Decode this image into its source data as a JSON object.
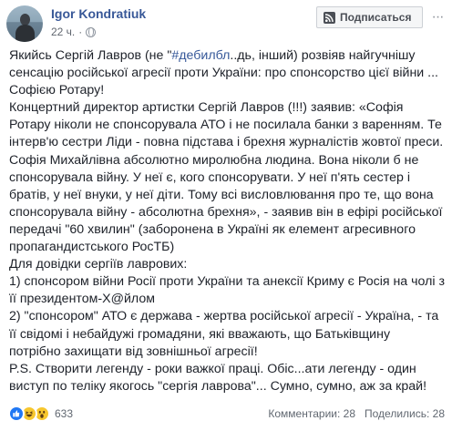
{
  "header": {
    "author": "Igor Kondratiuk",
    "time": "22 ч.",
    "separator": "·",
    "privacy_icon": "globe-icon",
    "subscribe_label": "Подписаться",
    "subscribe_icon": "rss-icon",
    "more_label": "···"
  },
  "post": {
    "p1_before": "Якийсь Сергій Лавров (не \"",
    "p1_hashtag": "#дебилбл",
    "p1_after": "..дь, інший) розвіяв найгучнішу сенсацію російської агресії проти України: про спонсорство цієї війни ... Софією Ротару!",
    "p2": "Концертний директор артистки Сергій Лавров (!!!) заявив: «Софія Ротару ніколи не спонсорувала АТО і не посилала банки з варенням. Те інтерв'ю сестри Ліди - повна підстава і брехня журналістів жовтої преси. Софія Михайлівна абсолютно миролюбна людина. Вона ніколи б не спонсорувала війну. У неї є, кого спонсорувати. У неї п'ять сестер і братів, у неї внуки, у неї діти. Тому всі висловлювання про те, що вона спонсорувала війну - абсолютна брехня», - заявив він в ефірі російської передачі \"60 хвилин\" (заборонена в Україні як елемент агресивного пропагандистського РосТБ)",
    "p3": "Для довідки сергіїв лаврових:",
    "p4": "1) спонсором війни Росії проти України та анексії Криму є Росія на чолі з її президентом-Х@йлом",
    "p5": "2) \"спонсором\" АТО є держава - жертва російської агресії - Україна, - та її свідомі і небайдужі громадяни, які вважають, що Батьківщину потрібно захищати від зовнішньої агресії!",
    "p6": "P.S. Створити легенду - роки важкої праці. Обіс...ати легенду - один виступ по теліку якогось \"сергія лаврова\"... Сумно, сумно, аж за край!"
  },
  "footer": {
    "reaction_icons": [
      "like-icon",
      "haha-icon",
      "wow-icon"
    ],
    "reaction_count": "633",
    "comments": "Комментарии: 28",
    "shares": "Поделились: 28"
  },
  "colors": {
    "link": "#385898",
    "hashtag": "#365899",
    "text": "#1d2129",
    "muted": "#606770",
    "like_blue": "#2078f4",
    "emoji_yellow": "#f7c72e"
  }
}
